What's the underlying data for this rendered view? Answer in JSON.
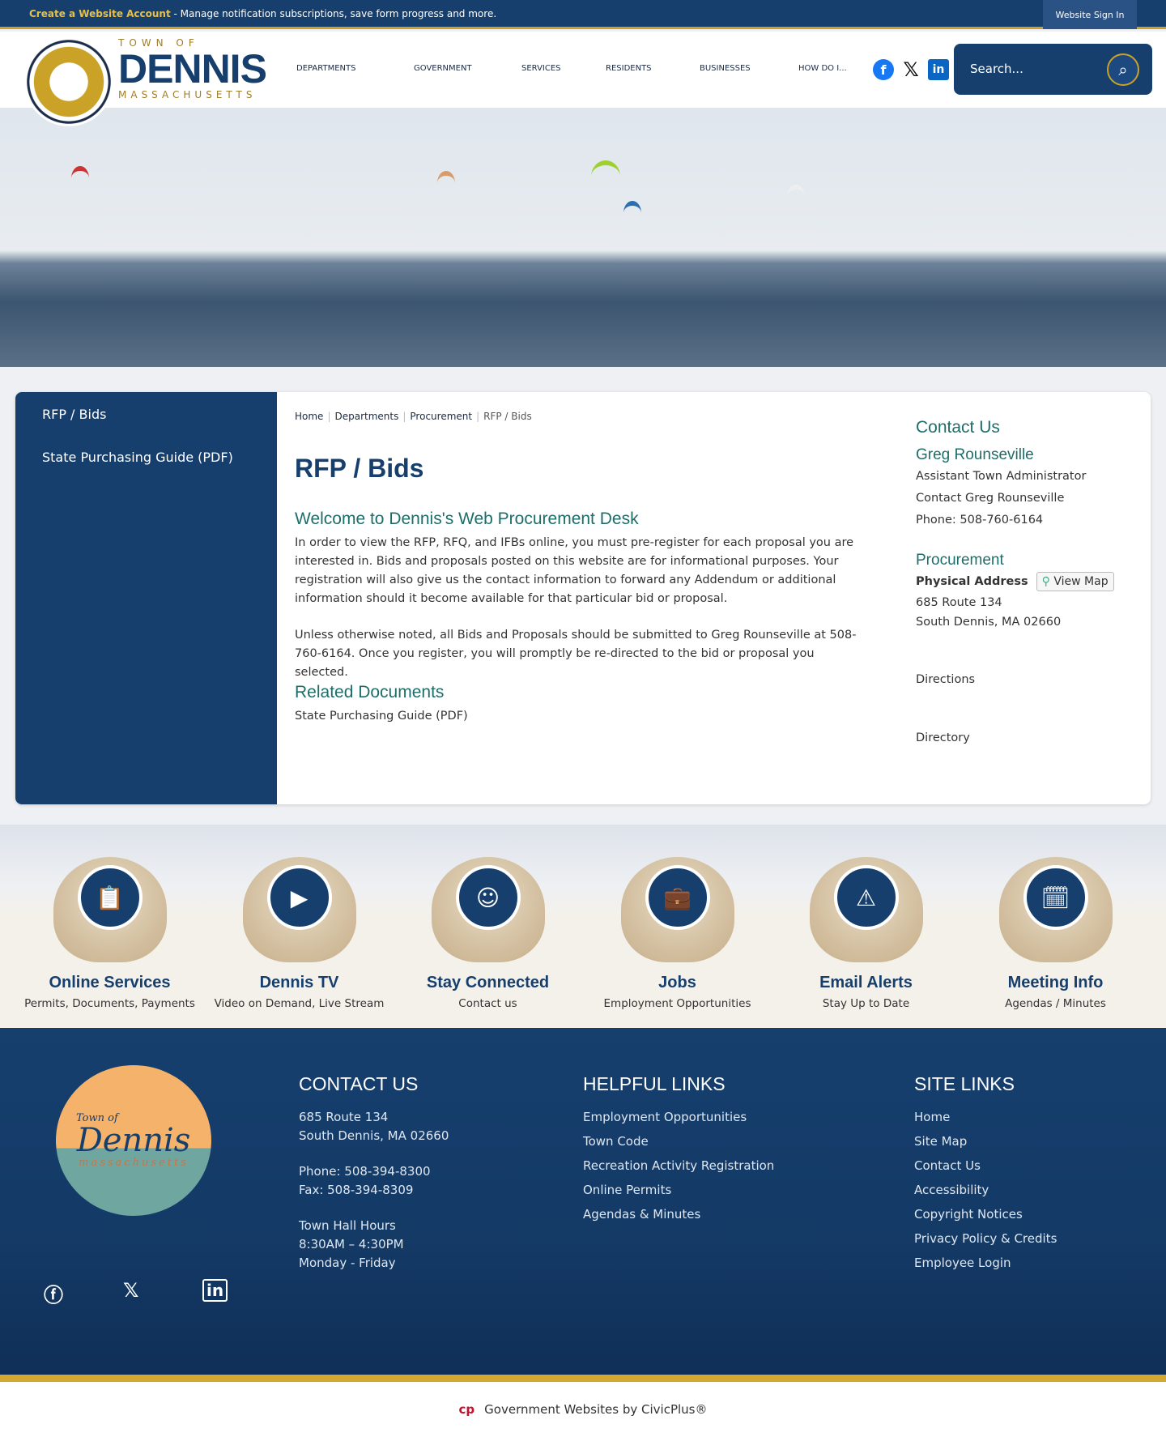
{
  "topbar": {
    "create_label": "Create a Website Account",
    "message": " - Manage notification subscriptions, save form progress and more.",
    "signin": "Website Sign In"
  },
  "logo": {
    "town_of": "TOWN OF",
    "name": "DENNIS",
    "state": "MASSACHUSETTS"
  },
  "nav": [
    "DEPARTMENTS",
    "GOVERNMENT",
    "SERVICES",
    "RESIDENTS",
    "BUSINESSES",
    "HOW DO I..."
  ],
  "search": {
    "placeholder": "Search..."
  },
  "sidebar": [
    "RFP / Bids",
    "State Purchasing Guide (PDF)"
  ],
  "breadcrumb": [
    "Home",
    "Departments",
    "Procurement",
    "RFP / Bids"
  ],
  "page": {
    "title": "RFP / Bids",
    "welcome": "Welcome to Dennis's Web Procurement Desk",
    "p1": "In order to view the RFP, RFQ, and IFBs online, you must pre-register for each proposal you are interested in. Bids and proposals posted on this website are for informational purposes. Your registration will also give us the contact information to forward any Addendum or additional information should it become available for that particular bid or proposal.",
    "p2": "Unless otherwise noted, all Bids and Proposals should be submitted to Greg Rounseville at 508-760-6164.  Once you register, you will promptly be re-directed to the bid or proposal you selected.",
    "related": "Related Documents",
    "doc": "State Purchasing Guide (PDF)"
  },
  "contact": {
    "heading": "Contact Us",
    "name": "Greg Rounseville",
    "role": "Assistant Town Administrator",
    "link": "Contact Greg Rounseville",
    "phone_label": "Phone: ",
    "phone": "508-760-6164",
    "dept": "Procurement",
    "addr_label": "Physical Address",
    "view_map": "View Map",
    "addr1": "685 Route 134",
    "addr2": "South Dennis, MA 02660",
    "directions": "Directions",
    "directory": "Directory"
  },
  "services": [
    {
      "title": "Online Services",
      "sub": "Permits, Documents, Payments"
    },
    {
      "title": "Dennis TV",
      "sub": "Video on Demand, Live Stream"
    },
    {
      "title": "Stay Connected",
      "sub": "Contact us"
    },
    {
      "title": "Jobs",
      "sub": "Employment Opportunities"
    },
    {
      "title": "Email Alerts",
      "sub": "Stay Up to Date"
    },
    {
      "title": "Meeting Info",
      "sub": "Agendas / Minutes"
    }
  ],
  "footer": {
    "logo_town": "Town of",
    "logo_name": "Dennis",
    "logo_state": "massachusetts",
    "contact_heading": "CONTACT US",
    "addr1": "685 Route 134",
    "addr2": "South Dennis, MA 02660",
    "phone": "Phone: 508-394-8300",
    "fax": "Fax: 508-394-8309",
    "hours_label": "Town Hall Hours",
    "hours": "8:30AM – 4:30PM",
    "days": "Monday - Friday",
    "helpful_heading": "HELPFUL LINKS",
    "helpful": [
      "Employment Opportunities",
      "Town Code",
      "Recreation Activity Registration",
      "Online Permits",
      "Agendas & Minutes"
    ],
    "site_heading": "SITE LINKS",
    "site": [
      "Home",
      "Site Map",
      "Contact Us",
      "Accessibility",
      "Copyright Notices",
      "Privacy Policy & Credits",
      "Employee Login"
    ]
  },
  "bottom": {
    "text": "Government Websites by CivicPlus®"
  },
  "colors": {
    "navy": "#163f6e",
    "gold": "#c9a227",
    "teal": "#1d6e6a"
  }
}
